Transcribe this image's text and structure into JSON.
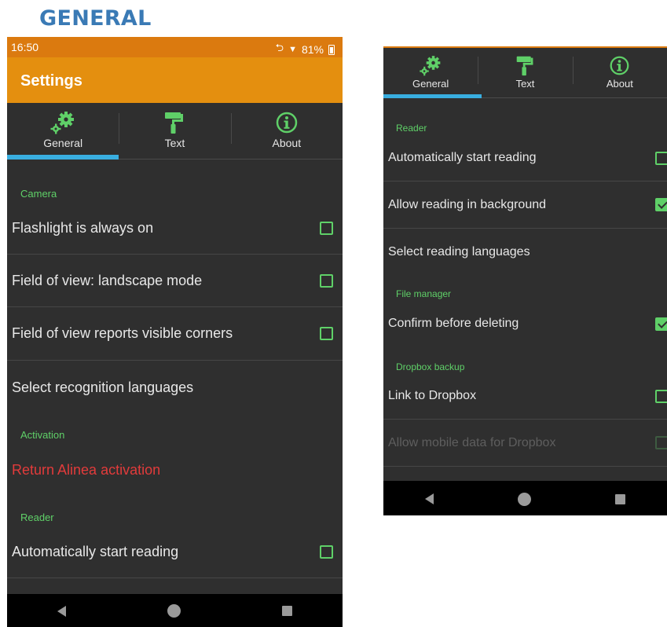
{
  "heading": "GENERAL",
  "colors": {
    "statusbar": "#db7a0f",
    "appbar": "#e48f0f",
    "background": "#2f2f2f",
    "section": "#5fd068",
    "indicator": "#39aee0",
    "danger": "#e23b3b",
    "heading": "#3a7ab5"
  },
  "left": {
    "status": {
      "time": "16:50",
      "battery": "81%",
      "icons": [
        "vibrate-icon",
        "wifi-icon",
        "battery-icon"
      ]
    },
    "appbar": {
      "title": "Settings"
    },
    "tabs": [
      {
        "label": "General",
        "icon": "gears-icon",
        "selected": true
      },
      {
        "label": "Text",
        "icon": "paint-roller-icon",
        "selected": false
      },
      {
        "label": "About",
        "icon": "info-icon",
        "selected": false
      }
    ],
    "sections": {
      "camera": "Camera",
      "activation": "Activation",
      "reader": "Reader"
    },
    "prefs": {
      "flashlight": {
        "label": "Flashlight is always on",
        "checked": false
      },
      "landscape": {
        "label": "Field of view: landscape mode",
        "checked": false
      },
      "corners": {
        "label": "Field of view reports visible corners",
        "checked": false
      },
      "recognition": {
        "label": "Select recognition languages"
      },
      "return_activation": {
        "label": "Return Alinea activation"
      },
      "auto_start": {
        "label": "Automatically start reading",
        "checked": false
      }
    },
    "nav": [
      "back-icon",
      "home-icon",
      "recent-apps-icon"
    ]
  },
  "right": {
    "tabs": [
      {
        "label": "General",
        "icon": "gears-icon",
        "selected": true
      },
      {
        "label": "Text",
        "icon": "paint-roller-icon",
        "selected": false
      },
      {
        "label": "About",
        "icon": "info-icon",
        "selected": false
      }
    ],
    "sections": {
      "reader": "Reader",
      "file_manager": "File manager",
      "dropbox": "Dropbox backup"
    },
    "prefs": {
      "auto_start": {
        "label": "Automatically start reading",
        "checked": false
      },
      "background": {
        "label": "Allow reading in background",
        "checked": true
      },
      "reading_languages": {
        "label": "Select reading languages"
      },
      "confirm_delete": {
        "label": "Confirm before deleting",
        "checked": true
      },
      "link_dropbox": {
        "label": "Link to Dropbox",
        "checked": false
      },
      "mobile_data": {
        "label": "Allow mobile data for Dropbox",
        "checked": false,
        "disabled": true
      }
    },
    "nav": [
      "back-icon",
      "home-icon",
      "recent-apps-icon"
    ]
  }
}
